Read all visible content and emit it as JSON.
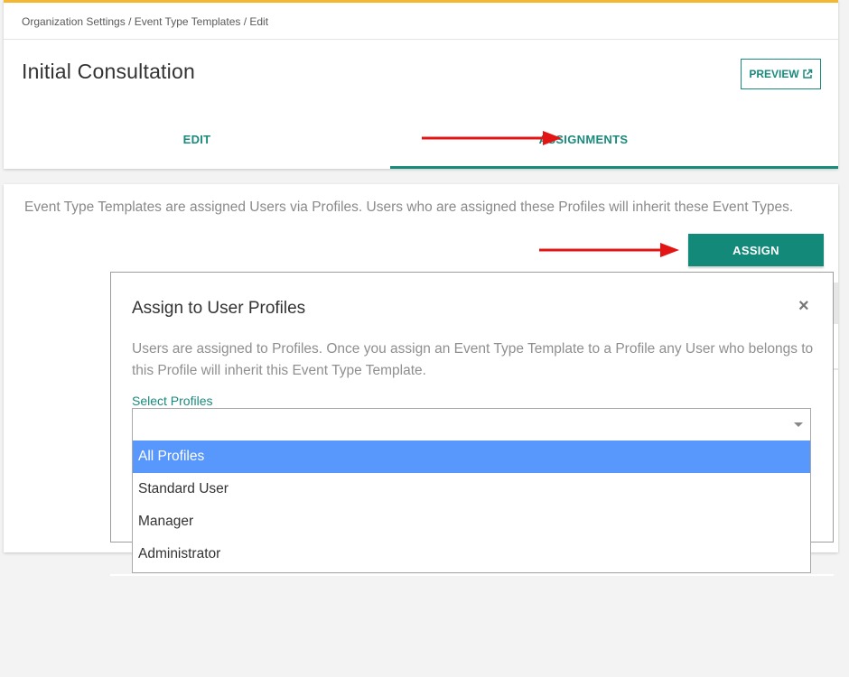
{
  "breadcrumb": "Organization Settings / Event Type Templates / Edit",
  "page_title": "Initial Consultation",
  "preview_label": "PREVIEW",
  "tabs": [
    {
      "label": "EDIT",
      "active": false
    },
    {
      "label": "ASSIGNMENTS",
      "active": true
    }
  ],
  "info_text": "Event Type Templates are assigned Users via Profiles. Users who are assigned these Profiles will inherit these Event Types.",
  "assign_label": "ASSIGN",
  "modal": {
    "title": "Assign to User Profiles",
    "close": "×",
    "description": "Users are assigned to Profiles. Once you assign an Event Type Template to a Profile any User who belongs to this Profile will inherit this Event Type Template.",
    "select_label": "Select Profiles",
    "select_value": "",
    "options": [
      "All Profiles",
      "Standard User",
      "Manager",
      "Administrator"
    ],
    "highlighted_option": "All Profiles"
  },
  "colors": {
    "accent": "#1a8a7d",
    "top_border": "#f5b731",
    "highlight": "#5897fb",
    "annotation_arrow": "#e31414"
  },
  "icons": [
    "external-link-icon",
    "close-icon",
    "caret-down-icon",
    "red-arrow-icon"
  ]
}
